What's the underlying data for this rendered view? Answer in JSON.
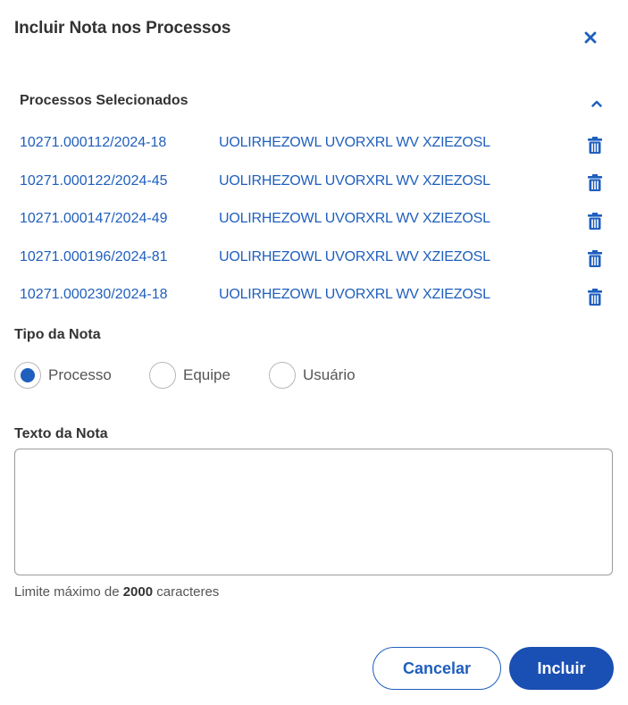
{
  "dialog": {
    "title": "Incluir Nota nos Processos"
  },
  "selected_section": {
    "title": "Processos Selecionados",
    "items": [
      {
        "number": "10271.000112/2024-18",
        "name": "UOLIRHEZOWL UVORXRL WV XZIEZOSL"
      },
      {
        "number": "10271.000122/2024-45",
        "name": "UOLIRHEZOWL UVORXRL WV XZIEZOSL"
      },
      {
        "number": "10271.000147/2024-49",
        "name": "UOLIRHEZOWL UVORXRL WV XZIEZOSL"
      },
      {
        "number": "10271.000196/2024-81",
        "name": "UOLIRHEZOWL UVORXRL WV XZIEZOSL"
      },
      {
        "number": "10271.000230/2024-18",
        "name": "UOLIRHEZOWL UVORXRL WV XZIEZOSL"
      }
    ]
  },
  "note_type": {
    "label": "Tipo da Nota",
    "options": [
      {
        "label": "Processo",
        "checked": true
      },
      {
        "label": "Equipe",
        "checked": false
      },
      {
        "label": "Usuário",
        "checked": false
      }
    ]
  },
  "note_text": {
    "label": "Texto da Nota",
    "value": "",
    "limit_prefix": "Limite máximo de",
    "limit_value": "2000",
    "limit_suffix": "caracteres"
  },
  "actions": {
    "cancel_label": "Cancelar",
    "submit_label": "Incluir"
  },
  "icons": {
    "close": "close-icon",
    "collapse": "chevron-up-icon",
    "delete": "trash-icon"
  },
  "colors": {
    "accent": "#1f5fbd",
    "primary_button": "#1a4fb3",
    "text": "#333333"
  }
}
